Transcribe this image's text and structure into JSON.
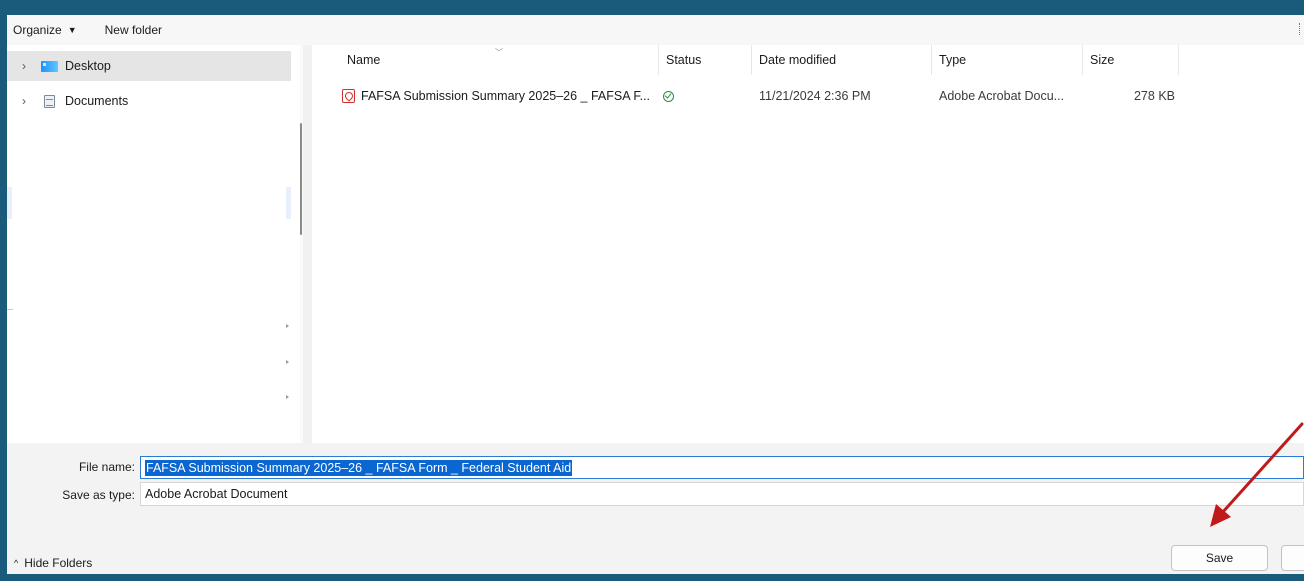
{
  "toolbar": {
    "organize_label": "Organize",
    "new_folder_label": "New folder"
  },
  "nav": {
    "items": [
      {
        "label": "Desktop",
        "selected": true
      },
      {
        "label": "Documents",
        "selected": false
      }
    ]
  },
  "columns": {
    "name": "Name",
    "status": "Status",
    "date_modified": "Date modified",
    "type": "Type",
    "size": "Size"
  },
  "files": [
    {
      "name": "FAFSA Submission Summary 2025–26 _ FAFSA F...",
      "status": "synced",
      "date_modified": "11/21/2024 2:36 PM",
      "type": "Adobe Acrobat Docu...",
      "size": "278 KB"
    }
  ],
  "form": {
    "file_name_label": "File name:",
    "file_name_value": "FAFSA Submission Summary 2025–26 _ FAFSA Form _ Federal Student Aid",
    "save_as_type_label": "Save as type:",
    "save_as_type_value": "Adobe Acrobat Document"
  },
  "footer": {
    "hide_folders_label": "Hide Folders",
    "save_label": "Save"
  },
  "colors": {
    "frame_border": "#1a5a7a",
    "selection": "#0a66d0",
    "annotation_arrow": "#c01a1a"
  },
  "icons": {
    "organize_caret": "chevron-down-icon",
    "desktop": "desktop-folder-icon",
    "documents": "documents-icon",
    "file": "pdf-icon",
    "status": "synced-check-icon",
    "hide_folders": "chevron-up-icon"
  }
}
